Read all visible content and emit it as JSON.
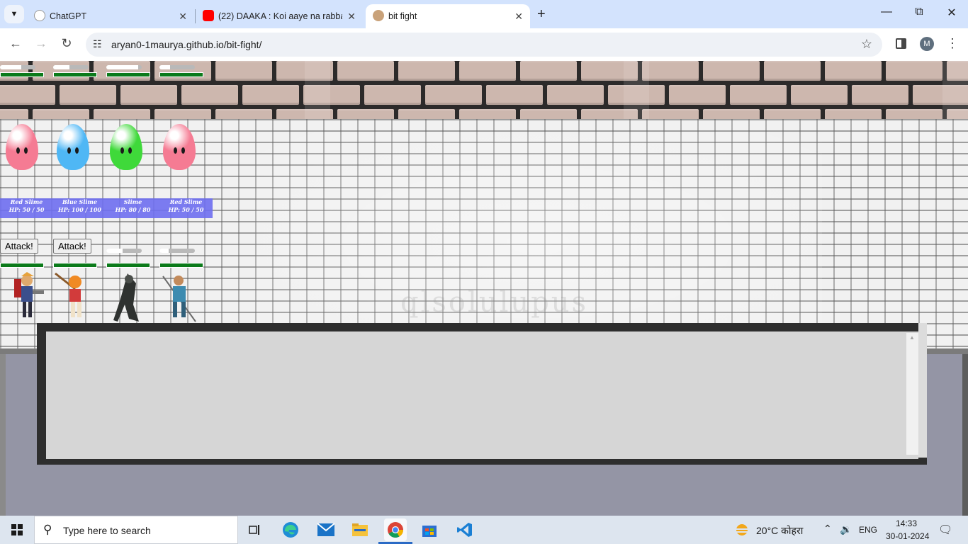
{
  "browser": {
    "tabs": [
      {
        "title": "ChatGPT",
        "favicon": "chatgpt-icon"
      },
      {
        "title": "(22) DAAKA : Koi aaye na rabba",
        "favicon": "youtube-icon"
      },
      {
        "title": "bit fight",
        "favicon": "bit-fight-icon"
      }
    ],
    "new_tab": "+",
    "url": "aryan0-1maurya.github.io/bit-fight/",
    "profile_initial": "M"
  },
  "game": {
    "enemies": [
      {
        "name": "Red Slime",
        "hp": "HP: 50 / 50",
        "color": "#f57b93",
        "hp_fraction": 1.0,
        "bar_fraction": 0.6
      },
      {
        "name": "Blue Slime",
        "hp": "HP: 100 / 100",
        "color": "#4fb7f5",
        "hp_fraction": 1.0,
        "bar_fraction": 0.45
      },
      {
        "name": "Slime",
        "hp": "HP: 80 / 80",
        "color": "#3fd93a",
        "hp_fraction": 1.0,
        "bar_fraction": 0.9
      },
      {
        "name": "Red Slime",
        "hp": "HP: 50 / 50",
        "color": "#f57b93",
        "hp_fraction": 1.0,
        "bar_fraction": 0.3
      }
    ],
    "heroes": [
      {
        "attack_label": "Attack!",
        "hp_fraction": 1.0
      },
      {
        "attack_label": "Attack!",
        "hp_fraction": 1.0
      },
      {
        "attack_label": "",
        "hp_fraction": 1.0,
        "bar_fraction": 0.45
      },
      {
        "attack_label": "",
        "hp_fraction": 1.0,
        "bar_fraction": 0.25
      }
    ],
    "floor_watermark": "qlsolulupus"
  },
  "taskbar": {
    "search_placeholder": "Type here to search",
    "weather": "20°C  कोहरा",
    "language": "ENG",
    "time": "14:33",
    "date": "30-01-2024",
    "apps": [
      "task-view-icon",
      "edge-icon",
      "mail-icon",
      "file-explorer-icon",
      "chrome-icon",
      "store-icon",
      "vscode-icon"
    ]
  }
}
